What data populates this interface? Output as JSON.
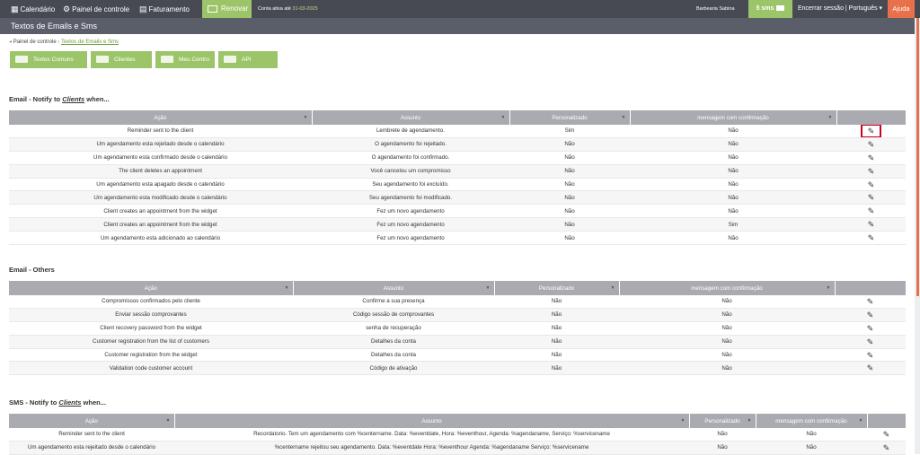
{
  "topbar": {
    "calendar": "Calendário",
    "control_panel": "Painel de controle",
    "billing": "Faturamento",
    "renew": "Renovar",
    "account_active_prefix": "Conta ativa até",
    "account_active_date": "31-03-2025",
    "shop_name": "Barbearia Sabina",
    "sms_count": "5 sms",
    "session": "Encerrar sessão | Português",
    "help": "Ajuda"
  },
  "page_title": "Textos de Emails e Sms",
  "breadcrumb": {
    "root": "Painel de controle",
    "current": "Textos de Emails e Sms"
  },
  "quick_buttons": [
    "Textos Comuns",
    "Clientes",
    "Meu Centro",
    "API"
  ],
  "sections": {
    "email_clients": {
      "title_prefix": "Email - Notify to",
      "title_em": "Clients",
      "title_suffix": "when..."
    },
    "email_others": {
      "title": "Email - Others"
    },
    "sms_clients": {
      "title_prefix": "SMS - Notify to",
      "title_em": "Clients",
      "title_suffix": "when..."
    }
  },
  "columns": {
    "action": "Ação",
    "subject": "Assunto",
    "custom": "Personalizado",
    "confirm": "mensagem com confirmação"
  },
  "email_clients_rows": [
    [
      "Reminder sent to the client",
      "Lembrete de agendamento.",
      "Sim",
      "Não"
    ],
    [
      "Um agendamento esta rejeitado desde o calendário",
      "O agendamento foi rejeitado.",
      "Não",
      "Não"
    ],
    [
      "Um agendamento esta confirmado desde o calendário",
      "O agendamento foi confirmado.",
      "Não",
      "Não"
    ],
    [
      "The client deletes an appointment",
      "Você cancelou um compromisso",
      "Não",
      "Não"
    ],
    [
      "Um agendamento esta apagado desde o calendário",
      "Seu agendamento foi excluído.",
      "Não",
      "Não"
    ],
    [
      "Um agendamento esta modificado desde o calendário",
      "Seu agendamento foi modificado.",
      "Não",
      "Não"
    ],
    [
      "Client creates an appointment from the widget",
      "Fez um novo agendamento",
      "Não",
      "Não"
    ],
    [
      "Client creates an appointment from the widget",
      "Fez um novo agendamento",
      "Não",
      "Sim"
    ],
    [
      "Um agendamento esta adicionado ao calendário",
      "Fez um novo agendamento",
      "Não",
      "Não"
    ]
  ],
  "email_others_rows": [
    [
      "Compromissos confirmados pelo cliente",
      "Confirme a sua presença",
      "Não",
      "Não"
    ],
    [
      "Enviar sessão comprovantes",
      "Código sessão de comprovantes",
      "Não",
      "Não"
    ],
    [
      "Client recovery password from the widget",
      "senha de recuperação",
      "Não",
      "Não"
    ],
    [
      "Customer registration from the list of customers",
      "Detalhes da conta",
      "Não",
      "Não"
    ],
    [
      "Customer registration from the widget",
      "Detalhes da conta",
      "Não",
      "Não"
    ],
    [
      "Validation code customer account",
      "Código de ativação",
      "Não",
      "Não"
    ]
  ],
  "sms_clients_rows": [
    [
      "Reminder sent to the client",
      "Recordatorio. Tem um agendamento com %centername. Data: %eventdate, Hora: %eventhour, Agenda: %agendaname, Serviço: %servicename",
      "Não",
      "Não"
    ],
    [
      "Um agendamento esta rejeitado desde o calendário",
      "%centername rejeitou seu agendamento. Data: %eventdate Hora: %eventhour Agenda: %agendaname Serviço: %servicename",
      "Não",
      "Não"
    ]
  ],
  "colors": {
    "topbar": "#474a53",
    "accent_green": "#9cc56a",
    "help_orange": "#e8704a",
    "highlight_red": "#d0021b"
  }
}
